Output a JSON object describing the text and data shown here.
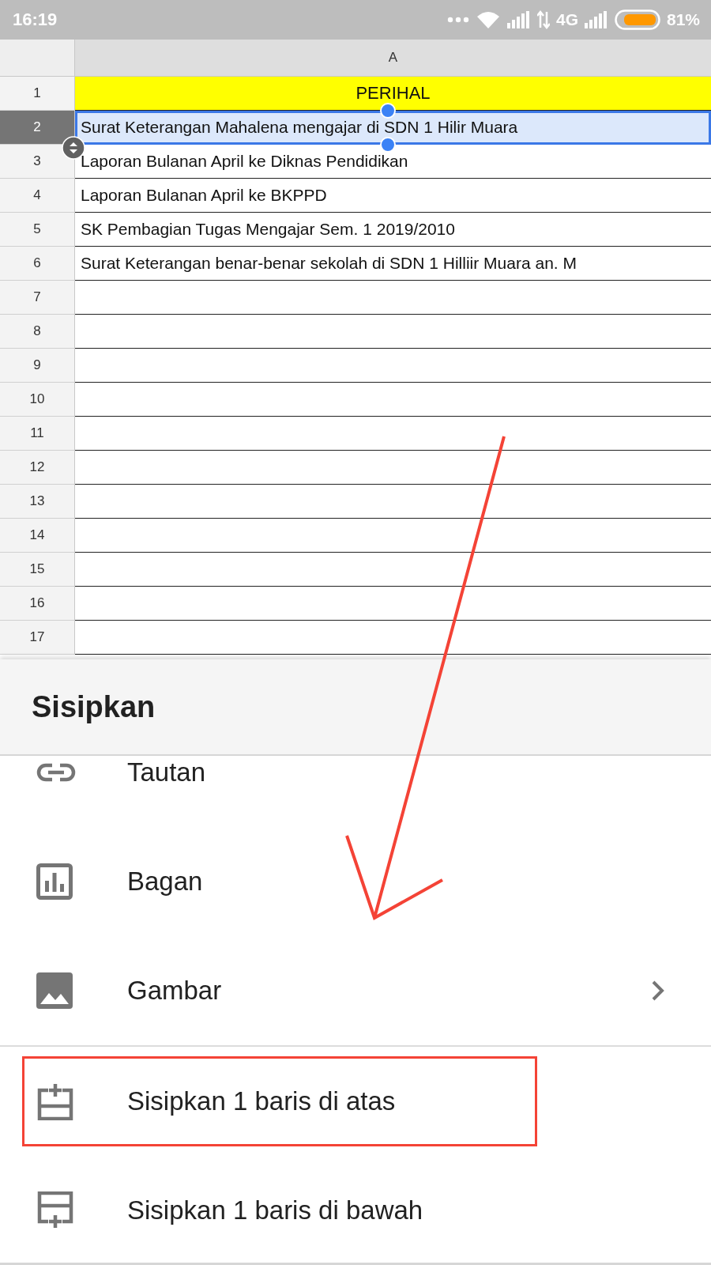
{
  "status_bar": {
    "time": "16:19",
    "network": "4G",
    "battery": "81%"
  },
  "sheet": {
    "column_header": "A",
    "rows": [
      {
        "number": "1",
        "text": "PERIHAL",
        "kind": "header",
        "selected": false
      },
      {
        "number": "2",
        "text": "Surat Keterangan Mahalena mengajar di SDN 1 Hilir Muara",
        "kind": "text",
        "selected": true
      },
      {
        "number": "3",
        "text": "Laporan Bulanan April ke Diknas Pendidikan",
        "kind": "text",
        "selected": false
      },
      {
        "number": "4",
        "text": "Laporan Bulanan April ke BKPPD",
        "kind": "text",
        "selected": false
      },
      {
        "number": "5",
        "text": "SK Pembagian Tugas Mengajar Sem. 1 2019/2010",
        "kind": "text",
        "selected": false
      },
      {
        "number": "6",
        "text": "Surat Keterangan benar-benar sekolah di SDN 1 Hilliir Muara an. M",
        "kind": "text",
        "selected": false
      },
      {
        "number": "7",
        "kind": "text",
        "selected": false
      },
      {
        "number": "8",
        "kind": "text",
        "selected": false
      },
      {
        "number": "9",
        "kind": "text",
        "selected": false
      },
      {
        "number": "10",
        "kind": "text",
        "selected": false
      },
      {
        "number": "11",
        "kind": "text",
        "selected": false
      },
      {
        "number": "12",
        "kind": "text",
        "selected": false
      },
      {
        "number": "13",
        "kind": "text",
        "selected": false
      },
      {
        "number": "14",
        "kind": "text",
        "selected": false
      },
      {
        "number": "15",
        "kind": "text",
        "selected": false
      },
      {
        "number": "16",
        "kind": "text",
        "selected": false
      },
      {
        "number": "17",
        "kind": "text",
        "selected": false
      }
    ]
  },
  "insert_menu": {
    "title": "Sisipkan",
    "items": [
      {
        "label": "Tautan",
        "submenu": false,
        "highlighted": false
      },
      {
        "label": "Bagan",
        "submenu": false,
        "highlighted": false
      },
      {
        "label": "Gambar",
        "submenu": true,
        "highlighted": false
      },
      {
        "label": "Sisipkan 1 baris di atas",
        "submenu": false,
        "highlighted": true
      },
      {
        "label": "Sisipkan 1 baris di bawah",
        "submenu": false,
        "highlighted": false
      }
    ]
  }
}
